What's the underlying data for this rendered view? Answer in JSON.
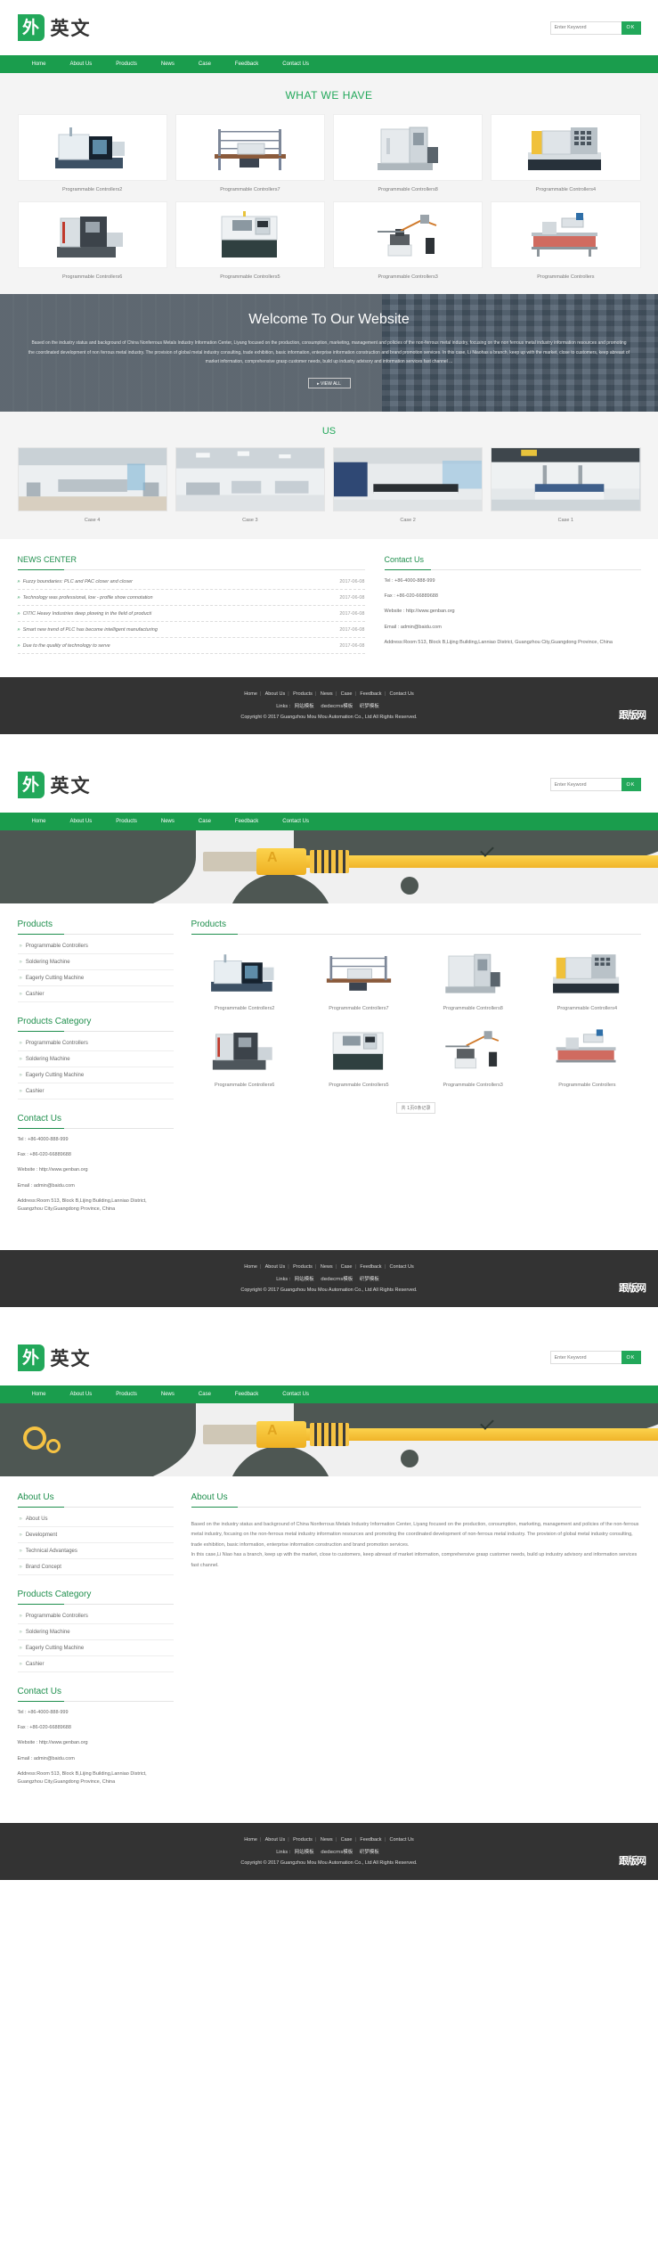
{
  "site": {
    "logo_mark": "外",
    "logo_text": "英文"
  },
  "search": {
    "placeholder": "Enter Keyword",
    "button": "OK",
    "value": ""
  },
  "nav": {
    "items": [
      "Home",
      "About Us",
      "Products",
      "News",
      "Case",
      "Feedback",
      "Contact Us"
    ]
  },
  "home": {
    "products_heading": "WHAT WE HAVE",
    "products": [
      {
        "label": "Programmable Controllers2"
      },
      {
        "label": "Programmable Controllers7"
      },
      {
        "label": "Programmable Controllers8"
      },
      {
        "label": "Programmable Controllers4"
      },
      {
        "label": "Programmable Controllers6"
      },
      {
        "label": "Programmable Controllers5"
      },
      {
        "label": "Programmable Controllers3"
      },
      {
        "label": "Programmable Controllers"
      }
    ],
    "welcome": {
      "title": "Welcome To Our Website",
      "body": "Based on the industry status and background of China Nonferrous Metals Industry Information Center, Liyang focused on the production, consumption, marketing, management and policies of the non-ferrous metal industry, focusing on the non ferrous metal industry information resources and promoting the coordinated development of non ferrous metal industry. The provision of global metal industry consulting, trade exhibition, basic information, enterprise information construction and brand promotion services. In this case, Li Niaohas a branch, keep up with the market, close to customers, keep abreast of market information, comprehensive grasp customer needs, build up industry advisory and information services fast channel ...",
      "view_all": "▸ VIEW ALL"
    },
    "cases_heading": "US",
    "cases": [
      {
        "label": "Case 4"
      },
      {
        "label": "Case 3"
      },
      {
        "label": "Case 2"
      },
      {
        "label": "Case 1"
      }
    ],
    "news": {
      "title": "NEWS CENTER",
      "items": [
        {
          "title": "Fuzzy boundaries: PLC and PAC closer and closer",
          "date": "2017-06-08"
        },
        {
          "title": "Technology was professional, low - profile show connotation",
          "date": "2017-06-08"
        },
        {
          "title": "CITIC Heavy Industries deep plowing in the field of producti",
          "date": "2017-06-08"
        },
        {
          "title": "Smart new trend of PLC has become intelligent manufacturing",
          "date": "2017-06-08"
        },
        {
          "title": "Due to the quality of technology to serve",
          "date": "2017-06-08"
        }
      ]
    }
  },
  "contact": {
    "title": "Contact Us",
    "tel": "Tel : +86-4000-888-999",
    "fax": "Fax : +86-020-66889688",
    "website": "Website : http://www.genban.org",
    "email": "Email : admin@baidu.com",
    "address": "Address:Room 513, Block B,Lijing Building,Lanniao District, Guangzhou City,Guangdong Province, China"
  },
  "footer": {
    "nav": [
      "Home",
      "About Us",
      "Products",
      "News",
      "Case",
      "Feedback",
      "Contact Us"
    ],
    "links_label": "Links :",
    "links": [
      "网站模板",
      "dedecms模板",
      "织梦模板"
    ],
    "copyright": "Copyright © 2017 Guangzhou Mou Mou Automation Co., Ltd All Rights Reserved.",
    "badge": "跟版网"
  },
  "products_page": {
    "sidebar": [
      {
        "title": "Products",
        "items": [
          "Programmable Controllers",
          "Soldering Machine",
          "Eagerly Cutting Machine",
          "Cashier"
        ]
      },
      {
        "title": "Products Category",
        "items": [
          "Programmable Controllers",
          "Soldering Machine",
          "Eagerly Cutting Machine",
          "Cashier"
        ]
      }
    ],
    "main_title": "Products",
    "products": [
      {
        "label": "Programmable Controllers2"
      },
      {
        "label": "Programmable Controllers7"
      },
      {
        "label": "Programmable Controllers8"
      },
      {
        "label": "Programmable Controllers4"
      },
      {
        "label": "Programmable Controllers6"
      },
      {
        "label": "Programmable Controllers5"
      },
      {
        "label": "Programmable Controllers3"
      },
      {
        "label": "Programmable Controllers"
      }
    ],
    "pager": "共 1页0条记录"
  },
  "about_page": {
    "sidebar": [
      {
        "title": "About Us",
        "items": [
          "About Us",
          "Development",
          "Technical Advantages",
          "Brand Concept"
        ]
      },
      {
        "title": "Products Category",
        "items": [
          "Programmable Controllers",
          "Soldering Machine",
          "Eagerly Cutting Machine",
          "Cashier"
        ]
      }
    ],
    "main_title": "About Us",
    "paragraph1": "Based on the industry status and background of China Nonferrous Metals Industry Information Center, Liyang focused on the production, consumption, marketing, management and policies of the non-ferrous metal industry, focusing on the non-ferrous metal industry information resources and promoting the coordinated development of non-ferrous metal industry. The provision of global metal industry consulting, trade exhibition, basic information, enterprise information construction and brand promotion services.",
    "paragraph2": "In this case,Li Niao has a branch, keep up with the market, close to customers, keep abreast of market information, comprehensive grasp customer needs, build up industry advisory and information services fast channel."
  },
  "colors": {
    "brand_green": "#22a85a",
    "nav_green": "#1a9d4d",
    "footer_dark": "#333333",
    "banner_dark": "#4e5753",
    "accent_yellow": "#f6c343"
  }
}
